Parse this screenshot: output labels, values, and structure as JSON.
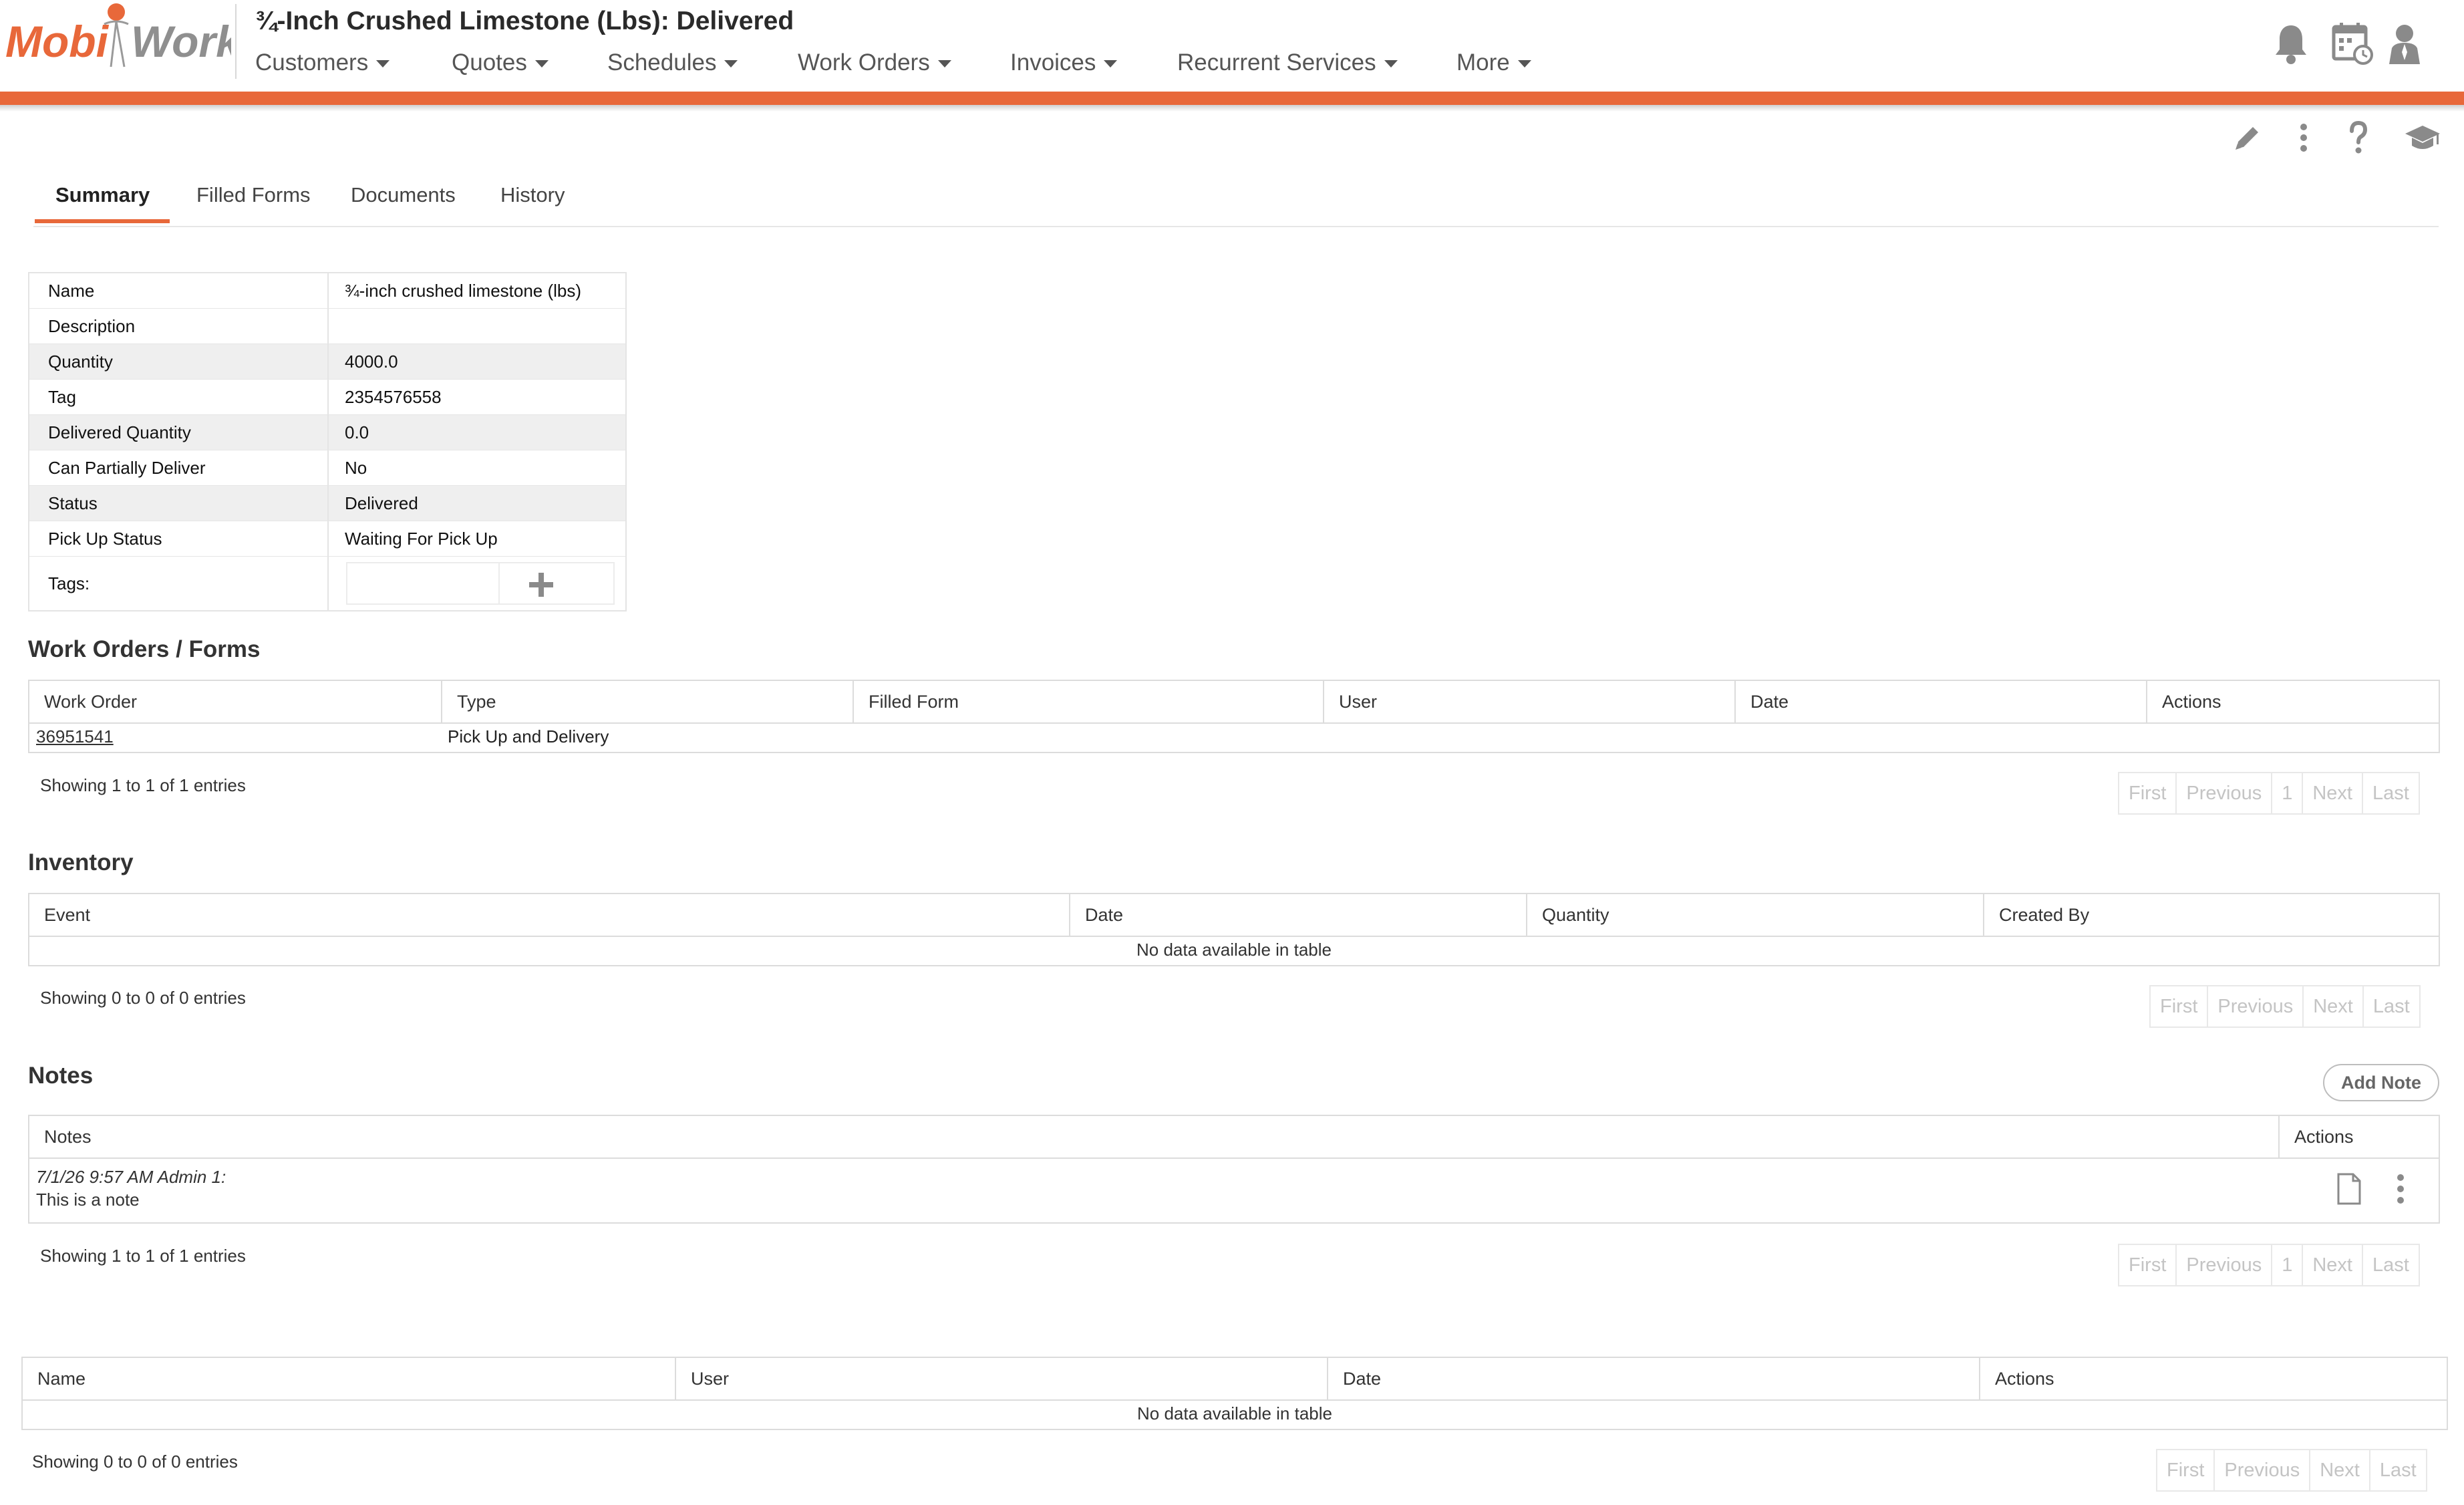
{
  "header": {
    "logo_text_left": "Mobi",
    "logo_text_right": "Work",
    "title": "¾-Inch Crushed Limestone (Lbs): Delivered",
    "nav": [
      {
        "label": "Customers"
      },
      {
        "label": "Quotes"
      },
      {
        "label": "Schedules"
      },
      {
        "label": "Work Orders"
      },
      {
        "label": "Invoices"
      },
      {
        "label": "Recurrent Services"
      },
      {
        "label": "More"
      }
    ],
    "icons": [
      "bell-icon",
      "calendar-icon",
      "user-icon"
    ],
    "accent_color": "#e8683a"
  },
  "toolbar": {
    "icons": [
      "edit-pencil-icon",
      "more-vertical-icon",
      "help-icon",
      "tutorial-graduation-cap-icon"
    ]
  },
  "tabs": [
    {
      "label": "Summary",
      "active": true
    },
    {
      "label": "Filled Forms"
    },
    {
      "label": "Documents"
    },
    {
      "label": "History"
    }
  ],
  "details": {
    "rows": [
      {
        "label": "Name",
        "value": "¾-inch crushed limestone (lbs)"
      },
      {
        "label": "Description",
        "value": ""
      },
      {
        "label": "Quantity",
        "value": "4000.0"
      },
      {
        "label": "Tag",
        "value": "2354576558"
      },
      {
        "label": "Delivered Quantity",
        "value": "0.0"
      },
      {
        "label": "Can Partially Deliver",
        "value": "No"
      },
      {
        "label": "Status",
        "value": "Delivered"
      },
      {
        "label": "Pick Up Status",
        "value": "Waiting For Pick Up"
      }
    ],
    "tags_label": "Tags:"
  },
  "work_orders": {
    "title": "Work Orders / Forms",
    "columns": [
      "Work Order",
      "Type",
      "Filled Form",
      "User",
      "Date",
      "Actions"
    ],
    "rows": [
      {
        "work_order": "36951541",
        "type": "Pick Up and Delivery",
        "filled_form": "",
        "user": "",
        "date": "",
        "actions": ""
      }
    ],
    "info": "Showing 1 to 1 of 1 entries",
    "pager": [
      "First",
      "Previous",
      "1",
      "Next",
      "Last"
    ]
  },
  "inventory": {
    "title": "Inventory",
    "columns": [
      "Event",
      "Date",
      "Quantity",
      "Created By"
    ],
    "empty": "No data available in table",
    "info": "Showing 0 to 0 of 0 entries",
    "pager": [
      "First",
      "Previous",
      "Next",
      "Last"
    ]
  },
  "notes": {
    "title": "Notes",
    "add_button": "Add Note",
    "columns": [
      "Notes",
      "Actions"
    ],
    "rows": [
      {
        "meta": "7/1/26 9:57 AM Admin 1:",
        "text": "This is a note"
      }
    ],
    "info": "Showing 1 to 1 of 1 entries",
    "pager": [
      "First",
      "Previous",
      "1",
      "Next",
      "Last"
    ]
  },
  "documents": {
    "columns": [
      "Name",
      "User",
      "Date",
      "Actions"
    ],
    "empty": "No data available in table",
    "info": "Showing 0 to 0 of 0 entries",
    "pager": [
      "First",
      "Previous",
      "Next",
      "Last"
    ]
  }
}
